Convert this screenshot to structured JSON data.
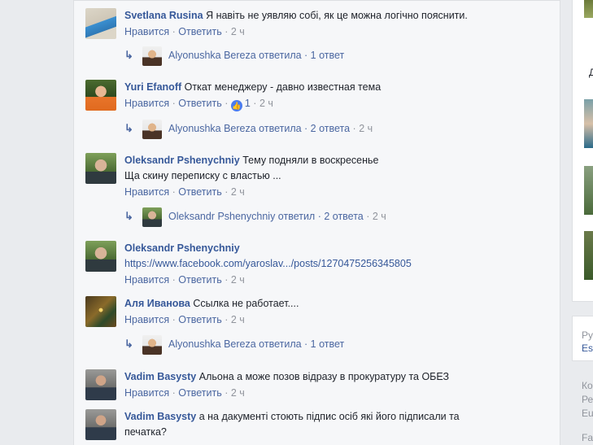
{
  "comments": [
    {
      "author": "Svetlana Rusina",
      "text": "Я навіть не уявляю собі, як це можна логічно пояснити.",
      "like_label": "Нравится",
      "reply_label": "Ответить",
      "time": "2 ч",
      "replies_summary": {
        "text": "Alyonushka Bereza ответила · 1 ответ",
        "time": ""
      }
    },
    {
      "author": "Yuri Efanoff",
      "text": "Откат менеджеру - давно известная тема",
      "like_label": "Нравится",
      "reply_label": "Ответить",
      "reactions": "1",
      "time": "2 ч",
      "replies_summary": {
        "text": "Alyonushka Bereza ответила · 2 ответа",
        "time": "2 ч"
      }
    },
    {
      "author": "Oleksandr Pshenychniy",
      "text": "Тему подняли в воскресенье",
      "text2": "Ща скину переписку с властью ...",
      "like_label": "Нравится",
      "reply_label": "Ответить",
      "time": "2 ч",
      "replies_summary": {
        "text": "Oleksandr Pshenychniy ответил · 2 ответа",
        "time": "2 ч"
      }
    },
    {
      "author": "Oleksandr Pshenychniy",
      "link": "https://www.facebook.com/yaroslav.../posts/1270475256345805",
      "like_label": "Нравится",
      "reply_label": "Ответить",
      "time": "2 ч"
    },
    {
      "author": "Аля Иванова",
      "text": "Ссылка не работает....",
      "like_label": "Нравится",
      "reply_label": "Ответить",
      "time": "2 ч",
      "replies_summary": {
        "text": "Alyonushka Bereza ответила · 1 ответ",
        "time": ""
      }
    },
    {
      "author": "Vadim Basysty",
      "text": "Альона а може позов відразу в прокуратуру та ОБЕЗ",
      "like_label": "Нравится",
      "reply_label": "Ответить",
      "time": "2 ч"
    },
    {
      "author": "Vadim Basysty",
      "text": "а на дакументі стоють підпис осіб які його підписали та",
      "text2": "печатка?"
    }
  ],
  "right_sidebar": {
    "letter": "Д",
    "lang_line1": "Ру",
    "lang_line2": "Es",
    "footer_lines": [
      "Ко",
      "Ре",
      "Eu"
    ],
    "footer_last": "Fa"
  },
  "icons": {
    "reply_arrow": "reply-arrow-icon",
    "like_badge": "thumbs-up-icon"
  },
  "colors": {
    "link": "#365899",
    "meta": "#90949c",
    "action": "#4b67a1",
    "background": "#e9ebee"
  }
}
